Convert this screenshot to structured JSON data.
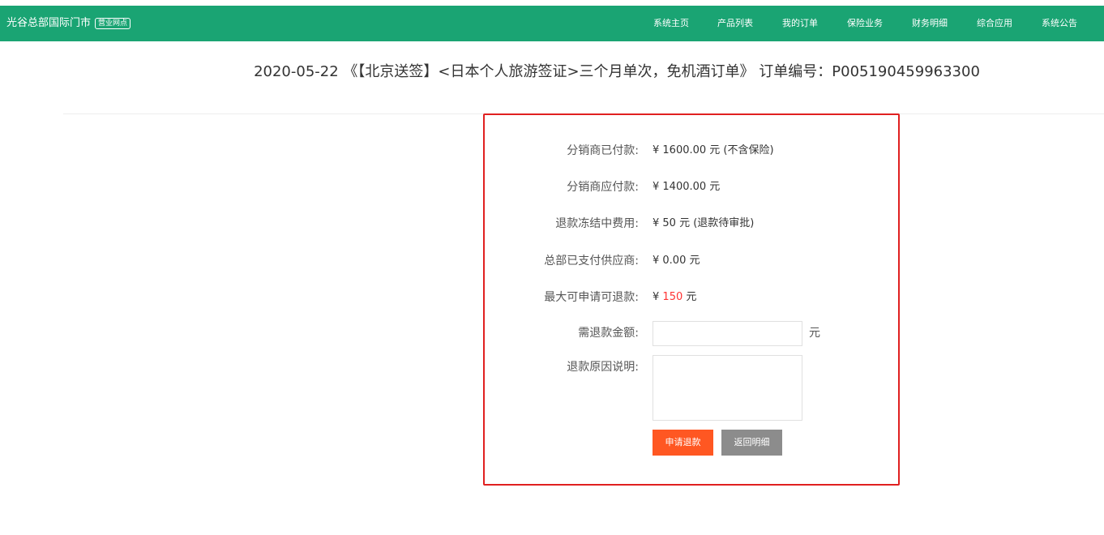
{
  "navbar": {
    "brand": "光谷总部国际门市",
    "badge": "营业网点",
    "items": [
      {
        "label": "系统主页"
      },
      {
        "label": "产品列表"
      },
      {
        "label": "我的订单"
      },
      {
        "label": "保险业务"
      },
      {
        "label": "财务明细"
      },
      {
        "label": "综合应用"
      },
      {
        "label": "系统公告"
      }
    ]
  },
  "order": {
    "title": "2020-05-22 《【北京送签】<日本个人旅游签证>三个月单次，免机酒订单》 订单编号：P005190459963300"
  },
  "refund": {
    "rows": [
      {
        "label": "分销商已付款:",
        "value": "¥ 1600.00 元 (不含保险)"
      },
      {
        "label": "分销商应付款:",
        "value": "¥ 1400.00 元"
      },
      {
        "label": "退款冻结中费用:",
        "value": "¥ 50 元 (退款待审批)"
      },
      {
        "label": "总部已支付供应商:",
        "value": "¥ 0.00 元"
      }
    ],
    "max_label": "最大可申请可退款:",
    "max_prefix": "¥",
    "max_amount": "150",
    "max_suffix": "元",
    "amount_label": "需退款金额:",
    "amount_value": "",
    "amount_unit": "元",
    "reason_label": "退款原因说明:",
    "reason_value": "",
    "apply_button": "申请退款",
    "back_button": "返回明细"
  },
  "colors": {
    "nav_bg": "#1aa473",
    "highlight_border": "#e02020",
    "apply_button": "#ff5722",
    "back_button": "#8c8c8c",
    "refund_amount": "#ff3333"
  }
}
